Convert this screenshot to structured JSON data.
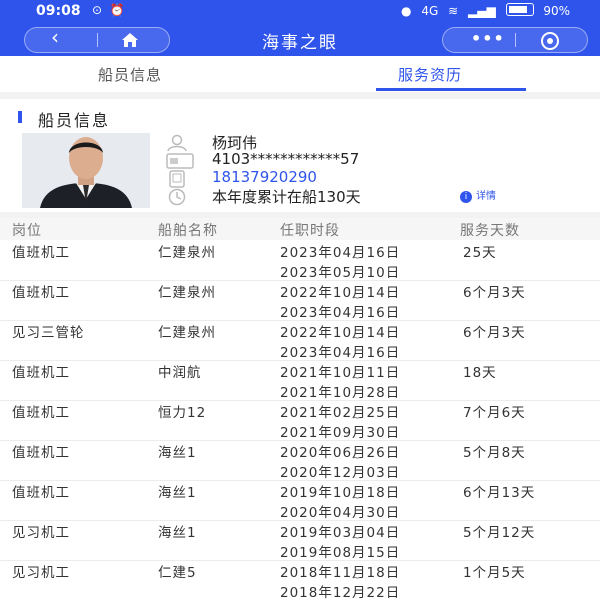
{
  "status": {
    "time": "09:08",
    "signal_text": "4G",
    "battery": "90%"
  },
  "header": {
    "title": "海事之眼",
    "back_icon": "chevron-left-icon",
    "home_icon": "home-icon",
    "more_icon": "more-dots-icon",
    "close_icon": "target-icon"
  },
  "tabs": [
    {
      "label": "船员信息",
      "active": false
    },
    {
      "label": "服务资历",
      "active": true
    }
  ],
  "crew": {
    "section_title": "船员信息",
    "name": "杨珂伟",
    "id_number": "4103************57",
    "phone": "18137920290",
    "days_summary": "本年度累计在船130天",
    "detail_label": "详情"
  },
  "table": {
    "headers": [
      "岗位",
      "船舶名称",
      "任职时段",
      "服务天数"
    ],
    "rows": [
      {
        "position": "值班机工",
        "ship": "仁建泉州",
        "start": "2023年04月16日",
        "end": "2023年05月10日",
        "days": "25天"
      },
      {
        "position": "值班机工",
        "ship": "仁建泉州",
        "start": "2022年10月14日",
        "end": "2023年04月16日",
        "days": "6个月3天"
      },
      {
        "position": "见习三管轮",
        "ship": "仁建泉州",
        "start": "2022年10月14日",
        "end": "2023年04月16日",
        "days": "6个月3天"
      },
      {
        "position": "值班机工",
        "ship": "中润航",
        "start": "2021年10月11日",
        "end": "2021年10月28日",
        "days": "18天"
      },
      {
        "position": "值班机工",
        "ship": "恒力12",
        "start": "2021年02月25日",
        "end": "2021年09月30日",
        "days": "7个月6天"
      },
      {
        "position": "值班机工",
        "ship": "海丝1",
        "start": "2020年06月26日",
        "end": "2020年12月03日",
        "days": "5个月8天"
      },
      {
        "position": "值班机工",
        "ship": "海丝1",
        "start": "2019年10月18日",
        "end": "2020年04月30日",
        "days": "6个月13天"
      },
      {
        "position": "见习机工",
        "ship": "海丝1",
        "start": "2019年03月04日",
        "end": "2019年08月15日",
        "days": "5个月12天"
      },
      {
        "position": "见习机工",
        "ship": "仁建5",
        "start": "2018年11月18日",
        "end": "2018年12月22日",
        "days": "1个月5天"
      }
    ]
  },
  "colors": {
    "brand": "#2f54eb",
    "divider": "#ececec"
  }
}
